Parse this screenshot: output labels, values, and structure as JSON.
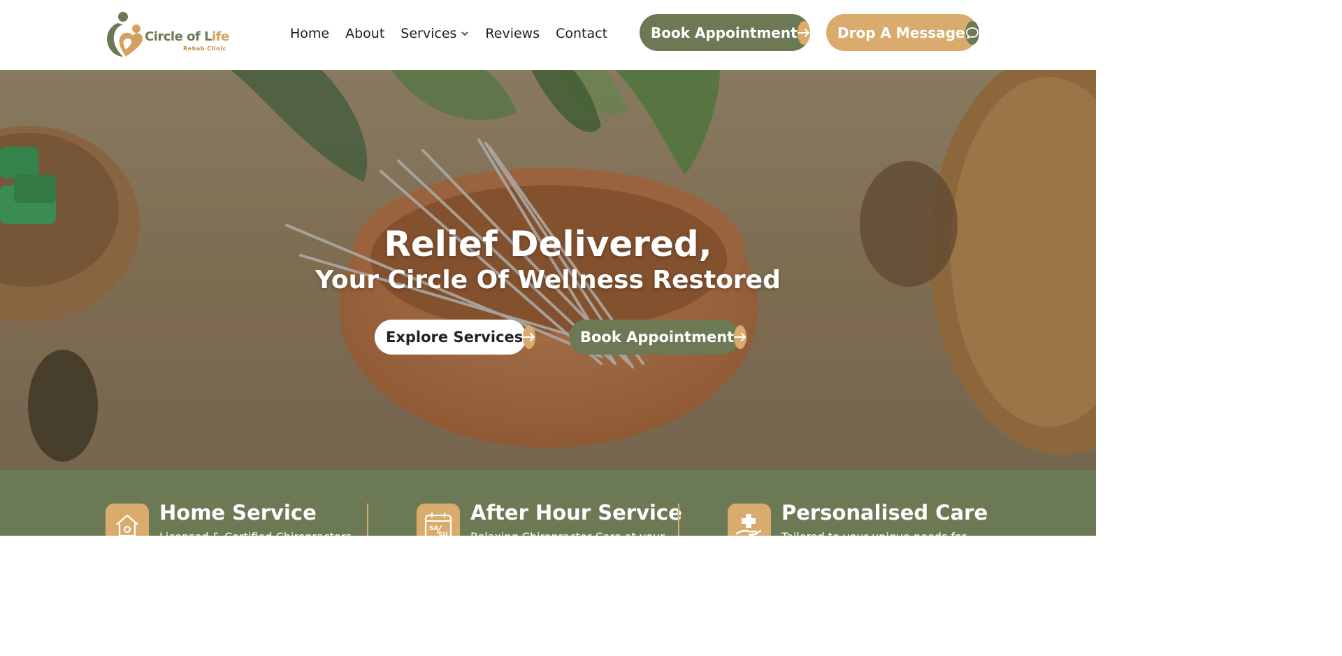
{
  "brand": {
    "logo_name_part1": "Circle of L",
    "logo_name_accent": "ife",
    "logo_sub": "Rehab Clinic"
  },
  "nav": {
    "items": [
      {
        "label": "Home"
      },
      {
        "label": "About"
      },
      {
        "label": "Services"
      },
      {
        "label": "Reviews"
      },
      {
        "label": "Contact"
      }
    ]
  },
  "header_buttons": {
    "book": "Book Appointment",
    "message": "Drop A Message"
  },
  "hero": {
    "title": "Relief Delivered,",
    "subtitle": "Your Circle Of Wellness Restored",
    "explore_label": "Explore Services",
    "book_label": "Book Appointment"
  },
  "features": [
    {
      "title": "Home Service",
      "desc": "Licensed & Certified Chiropractors",
      "icon": "home-location-icon"
    },
    {
      "title": "After Hour Service",
      "desc": "Relaxing Chiropractor Care at your",
      "icon": "calendar-weekend-icon"
    },
    {
      "title": "Personalised Care",
      "desc": "Tailored to your unique needs for"
    }
  ],
  "colors": {
    "brand_green": "#6b7a55",
    "brand_gold": "#d9ab6c",
    "white": "#ffffff"
  }
}
